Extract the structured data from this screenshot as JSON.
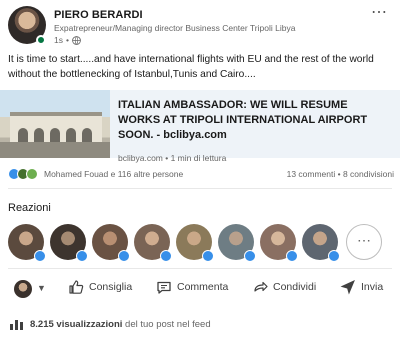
{
  "post": {
    "author": "PIERO BERARDI",
    "headline": "Expatrepreneur/Managing director Business Center Tripoli Libya",
    "time": "1s",
    "time_sep": "•",
    "text": "It is time to start.....and have international flights with EU and the rest of the world without the bottlenecking of Istanbul,Tunis and Cairo....",
    "more_icon": "⋯"
  },
  "link_card": {
    "title": "ITALIAN AMBASSADOR: WE WILL RESUME WORKS AT TRIPOLI INTERNATIONAL AIRPORT SOON.",
    "title_sep": " - ",
    "source": "bclibya.com",
    "domain": "bclibya.com",
    "sep": " • ",
    "read_time": "1 min di lettura"
  },
  "social": {
    "reactors": "Mohamed Fouad e 116 altre persone",
    "comments": "13 commenti",
    "sep": " • ",
    "shares": "8 condivisioni"
  },
  "reactions": {
    "title": "Reazioni",
    "more": "⋯",
    "count_avatars": 8,
    "avatar_colors": [
      "#5b4a3e",
      "#3d342e",
      "#6a5243",
      "#7a6455",
      "#8b7a5a",
      "#6e7d84",
      "#8a6f62",
      "#5e6670"
    ]
  },
  "actions": {
    "like": "Consiglia",
    "comment": "Commenta",
    "share": "Condividi",
    "send": "Invia"
  },
  "views": {
    "count": "8.215 visualizzazioni",
    "rest": " del tuo post nel feed"
  },
  "colors": {
    "accent": "#0a66c2",
    "online": "#057642",
    "like": "#378fe9"
  }
}
